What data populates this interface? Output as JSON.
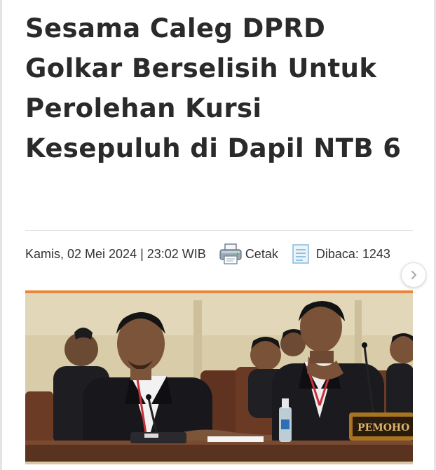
{
  "article": {
    "title": "Sesama Caleg DPRD Golkar Berselisih Untuk Perolehan Kursi Kesepuluh di Dapil NTB 6",
    "date_time": "Kamis, 02 Mei 2024 | 23:02 WIB",
    "print_label": "Cetak",
    "read_count_label": "Dibaca: 1243",
    "photo_sign": "PEMOHO"
  },
  "icons": {
    "print": "printer-icon",
    "read": "document-icon",
    "next": "chevron-right-icon"
  },
  "colors": {
    "accent": "#e8863b",
    "headline": "#2a2a2a",
    "meta_text": "#333333"
  }
}
